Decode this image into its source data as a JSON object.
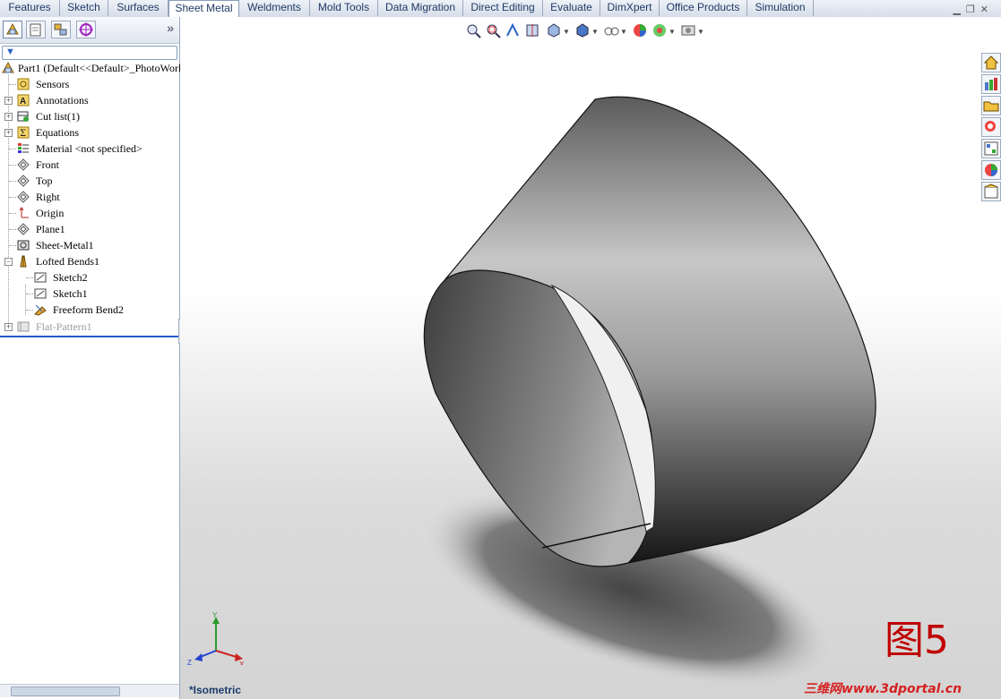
{
  "command_tabs": [
    "Features",
    "Sketch",
    "Surfaces",
    "Sheet Metal",
    "Weldments",
    "Mold Tools",
    "Data Migration",
    "Direct Editing",
    "Evaluate",
    "DimXpert",
    "Office Products",
    "Simulation"
  ],
  "active_tab": "Sheet Metal",
  "feature_tree": {
    "root": "Part1  (Default<<Default>_PhotoWorks",
    "items": [
      {
        "label": "Sensors",
        "icon": "sensors-icon"
      },
      {
        "label": "Annotations",
        "icon": "annotations-icon"
      },
      {
        "label": "Cut list(1)",
        "icon": "cut-list-icon"
      },
      {
        "label": "Equations",
        "icon": "equations-icon"
      },
      {
        "label": "Material <not specified>",
        "icon": "material-icon"
      },
      {
        "label": "Front",
        "icon": "plane-icon"
      },
      {
        "label": "Top",
        "icon": "plane-icon"
      },
      {
        "label": "Right",
        "icon": "plane-icon"
      },
      {
        "label": "Origin",
        "icon": "origin-icon"
      },
      {
        "label": "Plane1",
        "icon": "plane-icon"
      },
      {
        "label": "Sheet-Metal1",
        "icon": "sheet-metal-icon"
      },
      {
        "label": "Lofted Bends1",
        "icon": "lofted-bends-icon"
      },
      {
        "label": "Sketch2",
        "icon": "sketch-icon"
      },
      {
        "label": "Sketch1",
        "icon": "sketch-icon"
      },
      {
        "label": "Freeform Bend2",
        "icon": "freeform-bend-icon"
      },
      {
        "label": "Flat-Pattern1",
        "icon": "flat-pattern-icon"
      }
    ]
  },
  "viewport": {
    "view_name": "*Isometric",
    "figure_label": "图5",
    "watermark": "三维网www.3dportal.cn",
    "triad_axes": [
      "Y",
      "Z",
      "X"
    ]
  }
}
